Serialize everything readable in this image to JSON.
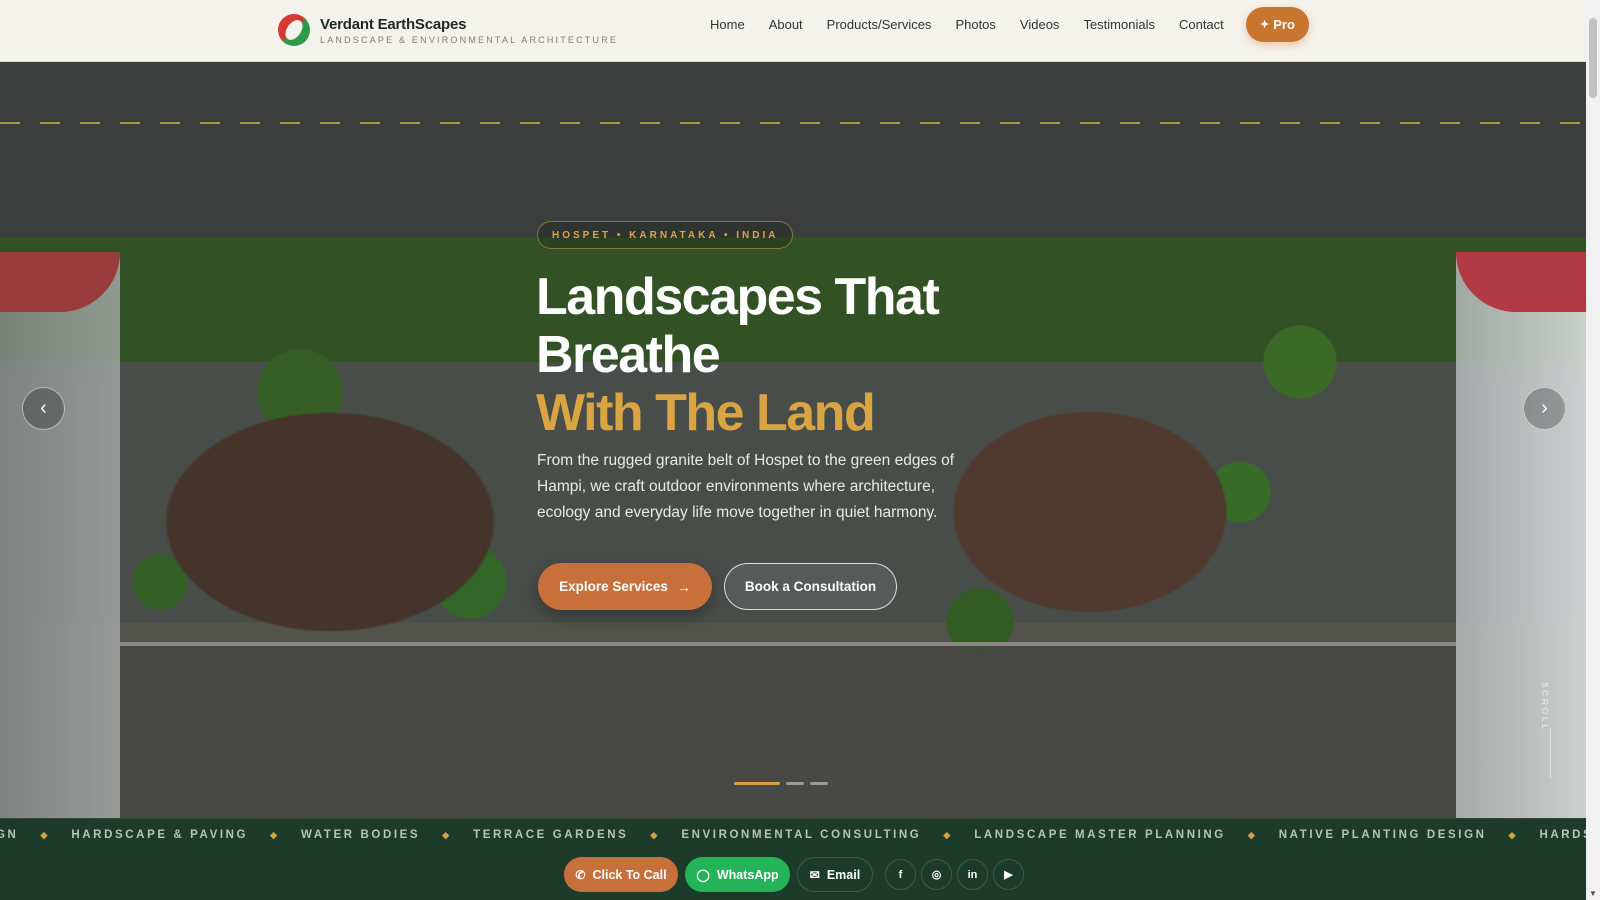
{
  "header": {
    "brand_name": "Verdant EarthScapes",
    "brand_tagline": "LANDSCAPE & ENVIRONMENTAL ARCHITECTURE",
    "nav": [
      "Home",
      "About",
      "Products/Services",
      "Photos",
      "Videos",
      "Testimonials",
      "Contact"
    ],
    "pro_label": "Pro"
  },
  "hero": {
    "location": "HOSPET • KARNATAKA • INDIA",
    "title_line1": "Landscapes That",
    "title_line2": "Breathe",
    "title_accent": "With The Land",
    "description": "From the rugged granite belt of Hospet to the green edges of Hampi, we craft outdoor environments where architecture, ecology and everyday life move together in quiet harmony.",
    "primary_button": "Explore Services",
    "primary_arrow": "→",
    "secondary_button": "Book a Consultation",
    "prev_arrow": "‹",
    "next_arrow": "›",
    "scroll_label": "SCROLL"
  },
  "marquee": {
    "items": [
      "GN",
      "HARDSCAPE & PAVING",
      "WATER BODIES",
      "TERRACE GARDENS",
      "ENVIRONMENTAL CONSULTING",
      "LANDSCAPE MASTER PLANNING",
      "NATIVE PLANTING DESIGN",
      "HARDS"
    ],
    "separator": "◆"
  },
  "actions": {
    "call": "Click To Call",
    "whatsapp": "WhatsApp",
    "email": "Email",
    "social_icons": [
      "facebook-icon",
      "instagram-icon",
      "linkedin-icon",
      "youtube-icon"
    ]
  },
  "colors": {
    "accent_orange": "#c8703a",
    "accent_gold": "#d9a441",
    "whatsapp_green": "#25b35a",
    "footer_green": "#1d3b2a"
  }
}
